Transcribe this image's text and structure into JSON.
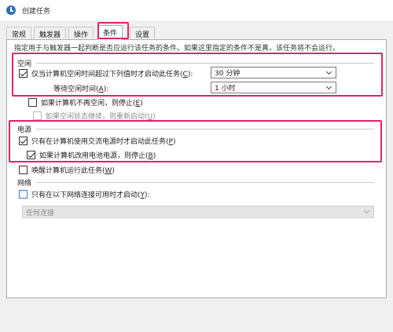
{
  "window": {
    "title": "创建任务"
  },
  "tabs": [
    {
      "label": "常规"
    },
    {
      "label": "触发器"
    },
    {
      "label": "操作"
    },
    {
      "label": "条件"
    },
    {
      "label": "设置"
    }
  ],
  "intro": "指定用于与触发器一起判断是否应运行该任务的条件。如果这里指定的条件不是真，该任务将不会运行。",
  "idle": {
    "title": "空闲",
    "start_only_if_idle": {
      "label": "仅当计算机空闲时间超过下列值时才启动此任务(",
      "key": "C",
      "tail": "):",
      "checked": true
    },
    "idle_time": {
      "value": "30 分钟"
    },
    "wait_label": {
      "label": "等待空闲时间(",
      "key": "A",
      "tail": "):"
    },
    "wait_time": {
      "value": "1 小时"
    },
    "stop_if_not_idle": {
      "label": "如果计算机不再空闲，则停止(",
      "key": "E",
      "tail": ")",
      "checked": false
    },
    "restart_if_idle": {
      "label": "如果空闲状态继续，则重新启动(",
      "key": "U",
      "tail": ")",
      "checked": false
    }
  },
  "power": {
    "title": "电源",
    "ac_only": {
      "label": "只有在计算机使用交流电源时才启动此任务(",
      "key": "P",
      "tail": ")",
      "checked": true
    },
    "stop_on_battery": {
      "label": "如果计算机改用电池电源，则停止(",
      "key": "B",
      "tail": ")",
      "checked": true
    },
    "wake": {
      "label": "唤醒计算机运行此任务(",
      "key": "W",
      "tail": ")",
      "checked": false
    }
  },
  "network": {
    "title": "网络",
    "start_only_if_network": {
      "label": "只有在以下网络连接可用时才启动(",
      "key": "Y",
      "tail": "):",
      "checked": false
    },
    "connection": {
      "value": "任何连接"
    }
  },
  "colors": {
    "accent": "#e2216e",
    "checkbox_focus": "#3b7fd8"
  }
}
